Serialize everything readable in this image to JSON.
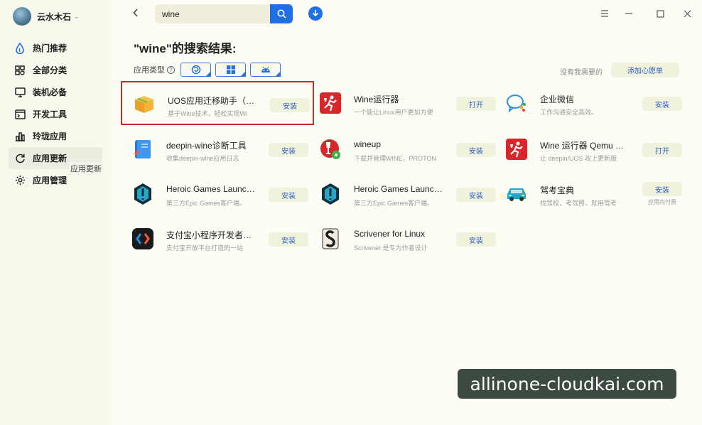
{
  "user": {
    "name": "云水木石"
  },
  "sidebar": {
    "items": [
      {
        "label": "热门推荐",
        "icon": "hot-drop-icon"
      },
      {
        "label": "全部分类",
        "icon": "grid-icon"
      },
      {
        "label": "装机必备",
        "icon": "monitor-icon"
      },
      {
        "label": "开发工具",
        "icon": "terminal-icon"
      },
      {
        "label": "玲珑应用",
        "icon": "chart-icon"
      },
      {
        "label": "应用更新",
        "icon": "refresh-icon"
      },
      {
        "label": "应用管理",
        "icon": "gear-icon"
      }
    ],
    "tooltip": "应用更新"
  },
  "search": {
    "value": "wine"
  },
  "results": {
    "title": "\"wine\"的搜索结果:",
    "filter_label": "应用类型",
    "wish_text": "没有我需要的",
    "wish_button": "添加心愿单"
  },
  "apps": [
    {
      "name": "UOS应用迁移助手（wi…",
      "desc": "基于Wine技术，轻松实现Wi",
      "action": "安装",
      "icon": "box-icon"
    },
    {
      "name": "Wine运行器",
      "desc": "一个能让Linux用户更加方便",
      "action": "打开",
      "icon": "wine-runner-icon"
    },
    {
      "name": "企业微信",
      "desc": "工作沟通安全高效。",
      "action": "安装",
      "icon": "wecom-icon"
    },
    {
      "name": "deepin-wine诊断工具",
      "desc": "收集deepin-wine应用日志",
      "action": "安装",
      "icon": "book-icon"
    },
    {
      "name": "wineup",
      "desc": "下载并管理WINE，PROTON",
      "action": "安装",
      "icon": "wineup-icon"
    },
    {
      "name": "Wine 运行器 Qemu 拓展",
      "desc": "让 deepin/UOS 攻上更新版",
      "action": "打开",
      "icon": "wine-runner-icon"
    },
    {
      "name": "Heroic Games Launcher",
      "desc": "第三方Epic Games客户端。",
      "action": "安装",
      "icon": "heroic-icon"
    },
    {
      "name": "Heroic Games Launcher",
      "desc": "第三方Epic Games客户端。",
      "action": "安装",
      "icon": "heroic-icon"
    },
    {
      "name": "驾考宝典",
      "desc": "找驾校，考驾照，就用驾考",
      "action": "安装",
      "sub": "应用内付费",
      "icon": "car-icon"
    },
    {
      "name": "支付宝小程序开发者工具",
      "desc": "支付宝开放平台打造的一站",
      "action": "安装",
      "icon": "code-icon"
    },
    {
      "name": "Scrivener for Linux",
      "desc": "Scrivener 是专为作者设计",
      "action": "安装",
      "icon": "scrivener-icon"
    }
  ],
  "watermark": "allinone-cloudkai.com",
  "colors": {
    "accent": "#1f6fe5",
    "highlight": "#cc2a2a",
    "button_bg": "#f1f2dc"
  }
}
